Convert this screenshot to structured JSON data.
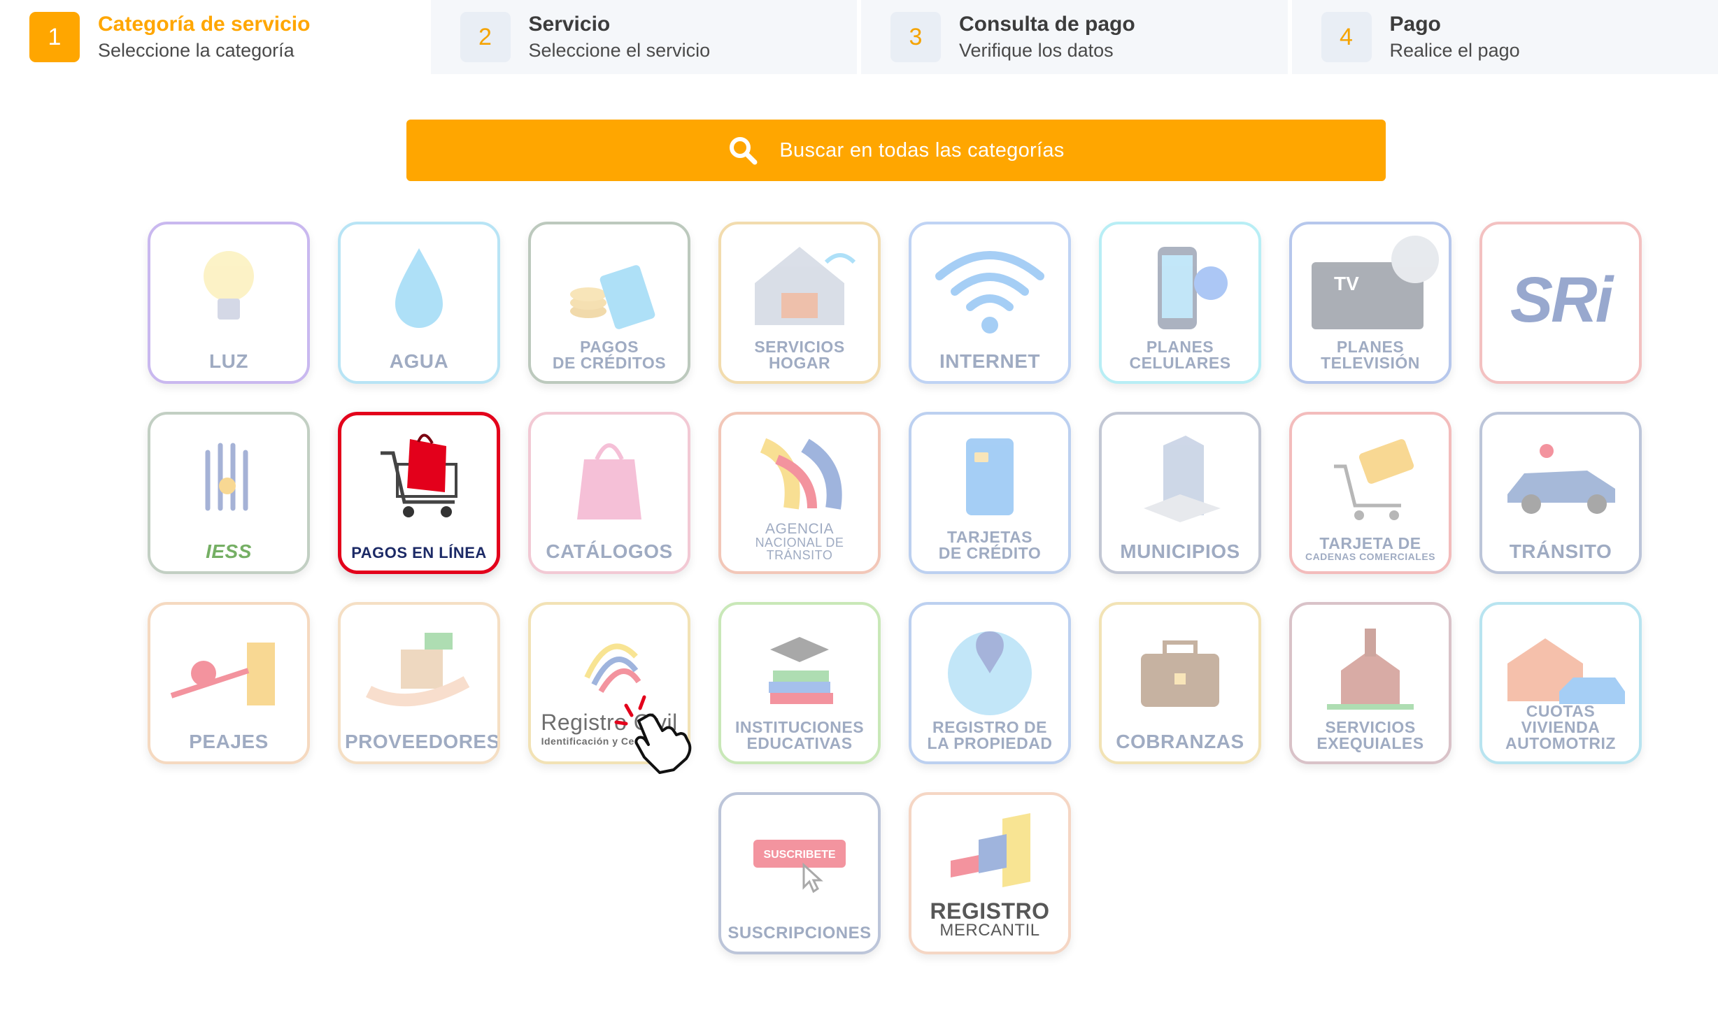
{
  "stepper": {
    "steps": [
      {
        "num": "1",
        "title": "Categoría de servicio",
        "subtitle": "Seleccione la categoría"
      },
      {
        "num": "2",
        "title": "Servicio",
        "subtitle": "Seleccione el servicio"
      },
      {
        "num": "3",
        "title": "Consulta de pago",
        "subtitle": "Verifique los datos"
      },
      {
        "num": "4",
        "title": "Pago",
        "subtitle": "Realice el pago"
      }
    ],
    "accent_color": "#ffa600"
  },
  "search": {
    "placeholder": "Buscar en todas las categorías",
    "icon": "search-icon"
  },
  "categories": [
    {
      "line1": "LUZ",
      "line2": "",
      "border": "#c9b8ef"
    },
    {
      "line1": "AGUA",
      "line2": "",
      "border": "#b8e4f5"
    },
    {
      "line1": "PAGOS",
      "line2": "DE CRÉDITOS",
      "border": "#bcc9bd"
    },
    {
      "line1": "SERVICIOS",
      "line2": "HOGAR",
      "border": "#f2dcae"
    },
    {
      "line1": "INTERNET",
      "line2": "",
      "border": "#bfd3f4"
    },
    {
      "line1": "PLANES",
      "line2": "CELULARES",
      "border": "#b8eef5"
    },
    {
      "line1": "PLANES",
      "line2": "TELEVISIÓN",
      "border": "#b6c7ec"
    },
    {
      "line1": "SRi",
      "line2": "",
      "border": "#f3c1c1"
    },
    {
      "line1": "IESS",
      "line2": "",
      "border": "#c2cfc3"
    },
    {
      "line1": "PAGOS EN LÍNEA",
      "line2": "",
      "border": "#e3001b"
    },
    {
      "line1": "CATÁLOGOS",
      "line2": "",
      "border": "#f2c9d4"
    },
    {
      "line1": "AGENCIA",
      "line2": "NACIONAL DE TRÁNSITO",
      "border": "#f2c7b8"
    },
    {
      "line1": "TARJETAS",
      "line2": "DE CRÉDITO",
      "border": "#bcd0f0"
    },
    {
      "line1": "MUNICIPIOS",
      "line2": "",
      "border": "#c2c7d4"
    },
    {
      "line1": "TARJETA DE",
      "line2": "CADENAS COMERCIALES",
      "border": "#f3bcbc"
    },
    {
      "line1": "TRÁNSITO",
      "line2": "",
      "border": "#bcc5d9"
    },
    {
      "line1": "PEAJES",
      "line2": "",
      "border": "#f5d9c0"
    },
    {
      "line1": "PROVEEDORES",
      "line2": "",
      "border": "#f5dfc4"
    },
    {
      "line1": "Registro Civil",
      "line2": "Identificación y Cedulación",
      "border": "#f2e2b5"
    },
    {
      "line1": "INSTITUCIONES",
      "line2": "EDUCATIVAS",
      "border": "#c9e8b8"
    },
    {
      "line1": "REGISTRO DE",
      "line2": "LA PROPIEDAD",
      "border": "#bcd0f0"
    },
    {
      "line1": "COBRANZAS",
      "line2": "",
      "border": "#f2e3b5"
    },
    {
      "line1": "SERVICIOS",
      "line2": "EXEQUIALES",
      "border": "#d9c2c8"
    },
    {
      "line1": "CUOTAS VIVIENDA",
      "line2": "AUTOMOTRIZ",
      "border": "#b8e4f0"
    },
    {
      "line1": "SUSCRIPCIONES",
      "line2": "",
      "border": "#bcc5d9"
    },
    {
      "line1": "REGISTRO",
      "line2": "MERCANTIL",
      "border": "#f5d6c4"
    }
  ],
  "suscripciones_button": "SUSCRIBETE",
  "tv_label": "TV",
  "selected_category": "PAGOS EN LÍNEA",
  "selected_color": "#e3001b"
}
